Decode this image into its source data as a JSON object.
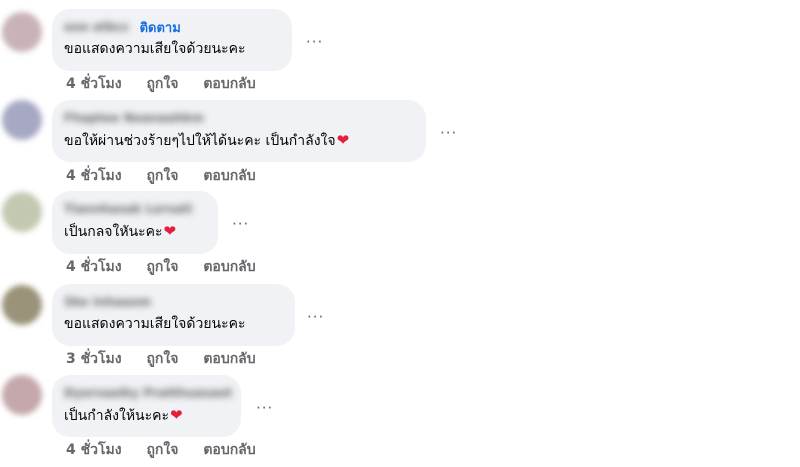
{
  "comments": [
    {
      "author": "ooo atbcc",
      "follow": "ติดตาม",
      "text": "ขอแสดงความเสียใจด้วยนะคะ",
      "heart": "",
      "time": "4 ชั่วโมง",
      "like": "ถูกใจ",
      "reply": "ตอบกลับ",
      "avatar_color": "#c9b3b7"
    },
    {
      "author": "Fhaptee Noanaahkm",
      "follow": "",
      "text": "ขอให้ผ่านช่วงร้ายๆไปให้ได้นะคะ เป็นกำลังใจ",
      "heart": "❤",
      "time": "4 ชั่วโมง",
      "like": "ถูกใจ",
      "reply": "ตอบกลับ",
      "avatar_color": "#a7a9c4"
    },
    {
      "author": "Tiannhasak Lorsati",
      "follow": "",
      "text": "เป็นกลจใหันะคะ",
      "heart": "❤",
      "time": "4 ชั่วโมง",
      "like": "ถูกใจ",
      "reply": "ตอบกลับ",
      "avatar_color": "#c2c9b0"
    },
    {
      "author": "Ske Inhaaom",
      "follow": "",
      "text": "ขอแสดงความเสียใจด้วยนะคะ",
      "heart": "",
      "time": "3 ชั่วโมง",
      "like": "ถูกใจ",
      "reply": "ตอบกลับ",
      "avatar_color": "#9a9279"
    },
    {
      "author": "Dyorsaaiky Pratthuasaot",
      "follow": "",
      "text": "เป็นกำลังให้นะคะ",
      "heart": "❤",
      "time": "4 ชั่วโมง",
      "like": "ถูกใจ",
      "reply": "ตอบกลับ",
      "avatar_color": "#c4a8ab"
    }
  ],
  "more_label": "···"
}
